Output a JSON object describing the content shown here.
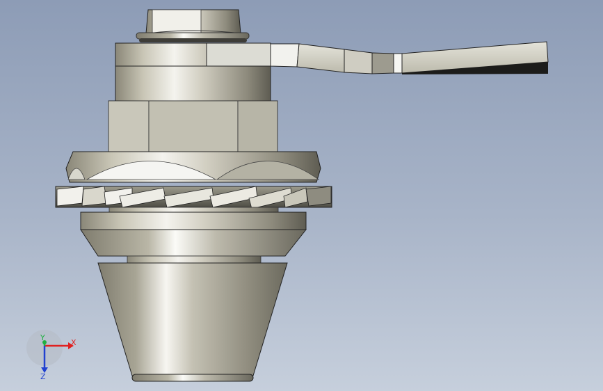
{
  "scene": {
    "part": "valve-assembly-front-view",
    "background_top": "#8d9cb6",
    "background_bottom": "#c6cfdc"
  },
  "triad": {
    "x_label": "X",
    "y_label": "Y",
    "z_label": "Z",
    "x_color": "#e02020",
    "y_color": "#20b040",
    "z_color": "#2040d0"
  }
}
